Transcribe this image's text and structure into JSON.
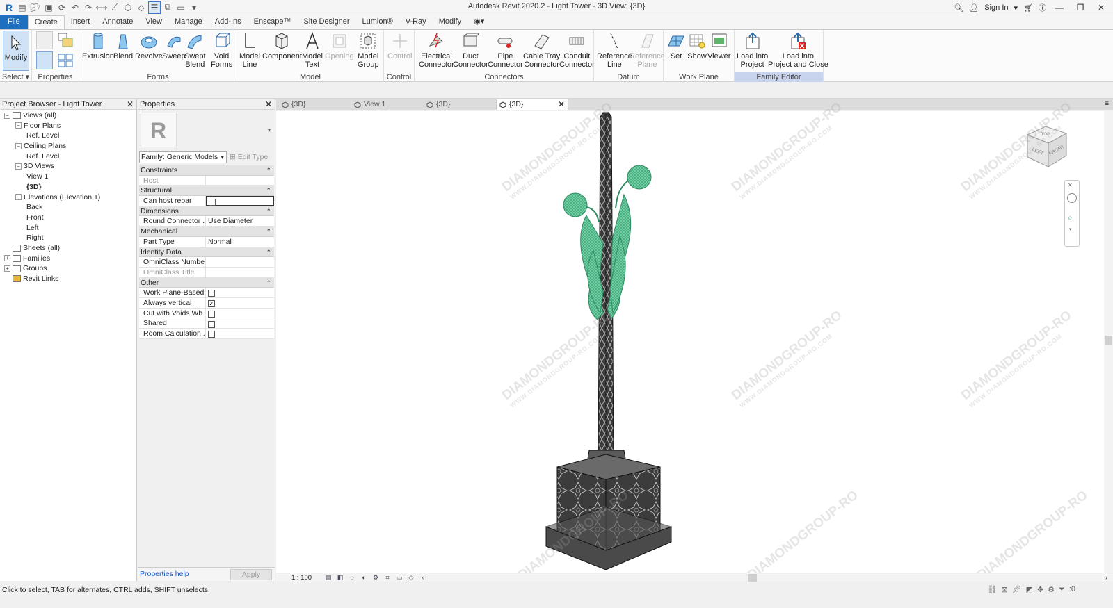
{
  "window": {
    "title": "Autodesk Revit 2020.2 - Light Tower - 3D View: {3D}",
    "sign_in": "Sign In"
  },
  "ribbon_tabs": [
    "File",
    "Create",
    "Insert",
    "Annotate",
    "View",
    "Manage",
    "Add-Ins",
    "Enscape™",
    "Site Designer",
    "Lumion®",
    "V-Ray",
    "Modify"
  ],
  "ribbon": {
    "modify": "Modify",
    "select_group": "Select",
    "properties_group": "Properties",
    "forms": {
      "title": "Forms",
      "buttons": [
        "Extrusion",
        "Blend",
        "Revolve",
        "Sweep",
        "Swept\nBlend",
        "Void\nForms"
      ]
    },
    "model": {
      "title": "Model",
      "buttons": [
        "Model\nLine",
        "Component",
        "Model\nText",
        "Opening",
        "Model\nGroup"
      ]
    },
    "control": {
      "title": "Control",
      "button": "Control"
    },
    "connectors": {
      "title": "Connectors",
      "buttons": [
        "Electrical\nConnector",
        "Duct\nConnector",
        "Pipe\nConnector",
        "Cable Tray\nConnector",
        "Conduit\nConnector"
      ]
    },
    "datum": {
      "title": "Datum",
      "buttons": [
        "Reference\nLine",
        "Reference\nPlane"
      ]
    },
    "work_plane": {
      "title": "Work Plane",
      "buttons": [
        "Set",
        "Show",
        "Viewer"
      ]
    },
    "family_editor": {
      "title": "Family Editor",
      "buttons": [
        "Load into\nProject",
        "Load into\nProject and Close"
      ]
    }
  },
  "project_browser": {
    "title": "Project Browser - Light Tower",
    "tree": [
      {
        "label": "Views (all)",
        "level": 0,
        "exp": "−",
        "icon": "views-icon"
      },
      {
        "label": "Floor Plans",
        "level": 1,
        "exp": "−"
      },
      {
        "label": "Ref. Level",
        "level": 2
      },
      {
        "label": "Ceiling Plans",
        "level": 1,
        "exp": "−"
      },
      {
        "label": "Ref. Level",
        "level": 2
      },
      {
        "label": "3D Views",
        "level": 1,
        "exp": "−"
      },
      {
        "label": "View 1",
        "level": 2
      },
      {
        "label": "{3D}",
        "level": 2,
        "bold": true
      },
      {
        "label": "Elevations (Elevation 1)",
        "level": 1,
        "exp": "−"
      },
      {
        "label": "Back",
        "level": 2
      },
      {
        "label": "Front",
        "level": 2
      },
      {
        "label": "Left",
        "level": 2
      },
      {
        "label": "Right",
        "level": 2
      },
      {
        "label": "Sheets (all)",
        "level": 0,
        "icon": "sheets-icon"
      },
      {
        "label": "Families",
        "level": 0,
        "exp": "+",
        "icon": "families-icon"
      },
      {
        "label": "Groups",
        "level": 0,
        "exp": "+",
        "icon": "groups-icon"
      },
      {
        "label": "Revit Links",
        "level": 0,
        "icon": "links-icon"
      }
    ]
  },
  "properties": {
    "title": "Properties",
    "family": "Family: Generic Models",
    "edit_type": "Edit Type",
    "help": "Properties help",
    "apply": "Apply",
    "rows": [
      {
        "type": "cat",
        "label": "Constraints"
      },
      {
        "type": "row",
        "key": "Host",
        "value": "",
        "disabled": true
      },
      {
        "type": "cat",
        "label": "Structural"
      },
      {
        "type": "row",
        "key": "Can host rebar",
        "check": false,
        "active": true
      },
      {
        "type": "cat",
        "label": "Dimensions"
      },
      {
        "type": "row",
        "key": "Round Connector ...",
        "value": "Use Diameter"
      },
      {
        "type": "cat",
        "label": "Mechanical"
      },
      {
        "type": "row",
        "key": "Part Type",
        "value": "Normal"
      },
      {
        "type": "cat",
        "label": "Identity Data"
      },
      {
        "type": "row",
        "key": "OmniClass Number",
        "value": ""
      },
      {
        "type": "row",
        "key": "OmniClass Title",
        "value": "",
        "disabled": true
      },
      {
        "type": "cat",
        "label": "Other"
      },
      {
        "type": "row",
        "key": "Work Plane-Based",
        "check": false
      },
      {
        "type": "row",
        "key": "Always vertical",
        "check": true
      },
      {
        "type": "row",
        "key": "Cut with Voids Wh...",
        "check": false
      },
      {
        "type": "row",
        "key": "Shared",
        "check": false
      },
      {
        "type": "row",
        "key": "Room Calculation ...",
        "check": false
      }
    ]
  },
  "view_tabs": [
    {
      "label": "{3D}",
      "active": false
    },
    {
      "label": "View 1",
      "active": false
    },
    {
      "label": "{3D}",
      "active": false
    },
    {
      "label": "{3D}",
      "active": true
    }
  ],
  "view": {
    "scale": "1 : 100",
    "viewcube": {
      "top": "TOP",
      "left": "LEFT",
      "front": "FRONT"
    }
  },
  "status": {
    "text": "Click to select, TAB for alternates, CTRL adds, SHIFT unselects.",
    "filter_count": ":0"
  },
  "watermark": {
    "main": "DIAMONDGROUP-RO",
    "sub": "WWW.DIAMONDGROUP-RO.COM"
  },
  "colors": {
    "accent": "#1e6fc0",
    "fixture": "#3aa87a",
    "tower": "#2a2a2a"
  }
}
